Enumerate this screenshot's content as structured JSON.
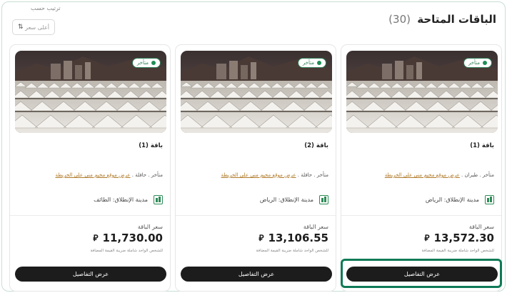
{
  "header": {
    "title": "الباقات المتاحة",
    "count": "(30)",
    "sort_label": "ترتيب حسب",
    "sort_value": "أعلى سعر",
    "sort_icon": "sort-arrows-icon"
  },
  "cards": [
    {
      "badge": "متأخر",
      "name": "باقة (1)",
      "meta_prefix": "متأخر . طيران . ",
      "map_link": "عرض موقع مخيم منى على الخريطة",
      "city": "مدينة الإنطلاق: الرياض",
      "price_label": "سعر الباقة",
      "price": "13,572.30",
      "currency_symbol": "⃁",
      "tax_note": "للشخص الواحد شاملة ضريبة القيمة المضافة",
      "button": "عرض التفاصيل"
    },
    {
      "badge": "متأخر",
      "name": "باقة (2)",
      "meta_prefix": "متأخر . حافلة . ",
      "map_link": "عرض موقع مخيم منى على الخريطة",
      "city": "مدينة الإنطلاق: الرياض",
      "price_label": "سعر الباقة",
      "price": "13,106.55",
      "currency_symbol": "⃁",
      "tax_note": "للشخص الواحد شاملة ضريبة القيمة المضافة",
      "button": "عرض التفاصيل"
    },
    {
      "badge": "متأخر",
      "name": "باقة (1)",
      "meta_prefix": "متأخر . حافلة . ",
      "map_link": "عرض موقع مخيم منى على الخريطة",
      "city": "مدينة الإنطلاق: الطائف",
      "price_label": "سعر الباقة",
      "price": "11,730.00",
      "currency_symbol": "⃁",
      "tax_note": "للشخص الواحد شاملة ضريبة القيمة المضافة",
      "button": "عرض التفاصيل"
    }
  ],
  "colors": {
    "accent": "#0f7a57",
    "button_bg": "#1c1c1c",
    "link": "#b07a2a",
    "badge": "#2e7d55"
  }
}
